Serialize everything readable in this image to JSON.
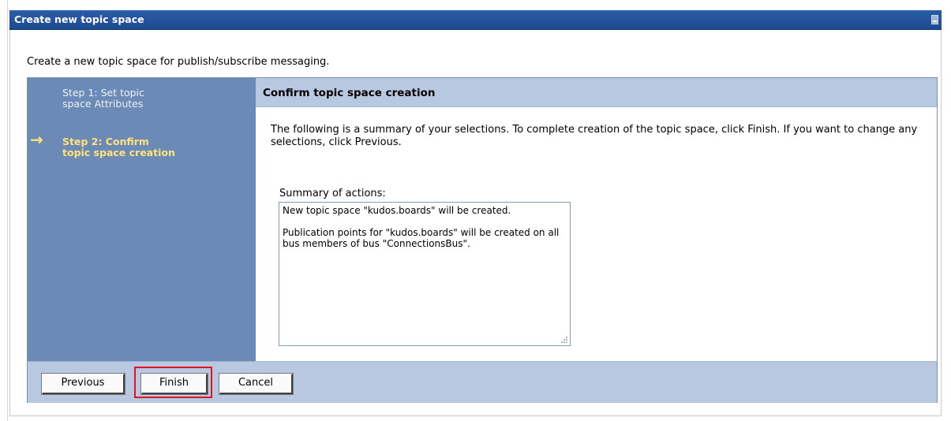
{
  "window": {
    "title": "Create new topic space"
  },
  "intro_text": "Create a new topic space for publish/subscribe messaging.",
  "steps": [
    {
      "label": "Step 1: Set topic space Attributes",
      "line1": "Step 1: Set topic",
      "line2": "space Attributes",
      "current": false
    },
    {
      "label": "Step 2: Confirm topic space creation",
      "line1": "Step 2: Confirm",
      "line2": "topic space creation",
      "current": true
    }
  ],
  "current_step_arrow": "→",
  "content": {
    "header": "Confirm topic space creation",
    "description": "The following is a summary of your selections. To complete creation of the topic space, click Finish. If you want to change any selections, click Previous.",
    "summary_label": "Summary of actions:",
    "summary_text": "New topic space \"kudos.boards\" will be created.\n\nPublication points for \"kudos.boards\" will be created on all bus members of bus \"ConnectionsBus\"."
  },
  "buttons": {
    "previous": "Previous",
    "finish": "Finish",
    "cancel": "Cancel"
  },
  "colors": {
    "titlebar": "#1f4e96",
    "step_pane": "#6b8ab6",
    "current_step": "#ffe37a",
    "header_bg": "#b7c8e0",
    "highlight": "#e0141c"
  }
}
